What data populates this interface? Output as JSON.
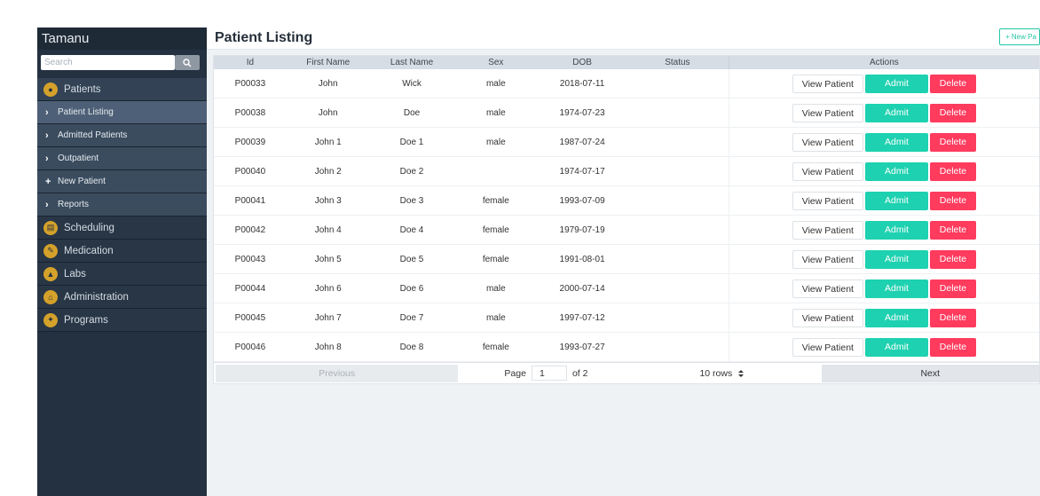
{
  "sidebar": {
    "brand": "Tamanu",
    "search_placeholder": "Search",
    "items": [
      {
        "label": "Patients",
        "type": "top",
        "icon": "patients-icon"
      },
      {
        "label": "Patient Listing",
        "type": "sub",
        "active": true
      },
      {
        "label": "Admitted Patients",
        "type": "sub"
      },
      {
        "label": "Outpatient",
        "type": "sub"
      },
      {
        "label": "New Patient",
        "type": "sub-plus"
      },
      {
        "label": "Reports",
        "type": "sub"
      },
      {
        "label": "Scheduling",
        "type": "plain",
        "icon": "scheduling-icon"
      },
      {
        "label": "Medication",
        "type": "plain",
        "icon": "medication-icon"
      },
      {
        "label": "Labs",
        "type": "plain",
        "icon": "labs-icon"
      },
      {
        "label": "Administration",
        "type": "plain",
        "icon": "administration-icon"
      },
      {
        "label": "Programs",
        "type": "plain",
        "icon": "programs-icon"
      }
    ]
  },
  "header": {
    "title": "Patient Listing",
    "new_button": "+ New Pa"
  },
  "table": {
    "columns": [
      "Id",
      "First Name",
      "Last Name",
      "Sex",
      "DOB",
      "Status",
      "Actions"
    ],
    "actions": {
      "view": "View Patient",
      "admit": "Admit",
      "delete": "Delete"
    },
    "rows": [
      {
        "id": "P00033",
        "first": "John",
        "last": "Wick",
        "sex": "male",
        "dob": "2018-07-11",
        "status": ""
      },
      {
        "id": "P00038",
        "first": "John",
        "last": "Doe",
        "sex": "male",
        "dob": "1974-07-23",
        "status": ""
      },
      {
        "id": "P00039",
        "first": "John 1",
        "last": "Doe 1",
        "sex": "male",
        "dob": "1987-07-24",
        "status": ""
      },
      {
        "id": "P00040",
        "first": "John 2",
        "last": "Doe 2",
        "sex": "",
        "dob": "1974-07-17",
        "status": ""
      },
      {
        "id": "P00041",
        "first": "John 3",
        "last": "Doe 3",
        "sex": "female",
        "dob": "1993-07-09",
        "status": ""
      },
      {
        "id": "P00042",
        "first": "John 4",
        "last": "Doe 4",
        "sex": "female",
        "dob": "1979-07-19",
        "status": ""
      },
      {
        "id": "P00043",
        "first": "John 5",
        "last": "Doe 5",
        "sex": "female",
        "dob": "1991-08-01",
        "status": ""
      },
      {
        "id": "P00044",
        "first": "John 6",
        "last": "Doe 6",
        "sex": "male",
        "dob": "2000-07-14",
        "status": ""
      },
      {
        "id": "P00045",
        "first": "John 7",
        "last": "Doe 7",
        "sex": "male",
        "dob": "1997-07-12",
        "status": ""
      },
      {
        "id": "P00046",
        "first": "John 8",
        "last": "Doe 8",
        "sex": "female",
        "dob": "1993-07-27",
        "status": ""
      }
    ]
  },
  "pagination": {
    "previous": "Previous",
    "page_label": "Page",
    "page_value": "1",
    "of_label": "of 2",
    "rows_select": "10 rows",
    "next": "Next"
  },
  "colors": {
    "sidebar_bg": "#243141",
    "admit": "#1ed1b0",
    "delete": "#ff3b5e",
    "accent": "#25c6a5"
  }
}
